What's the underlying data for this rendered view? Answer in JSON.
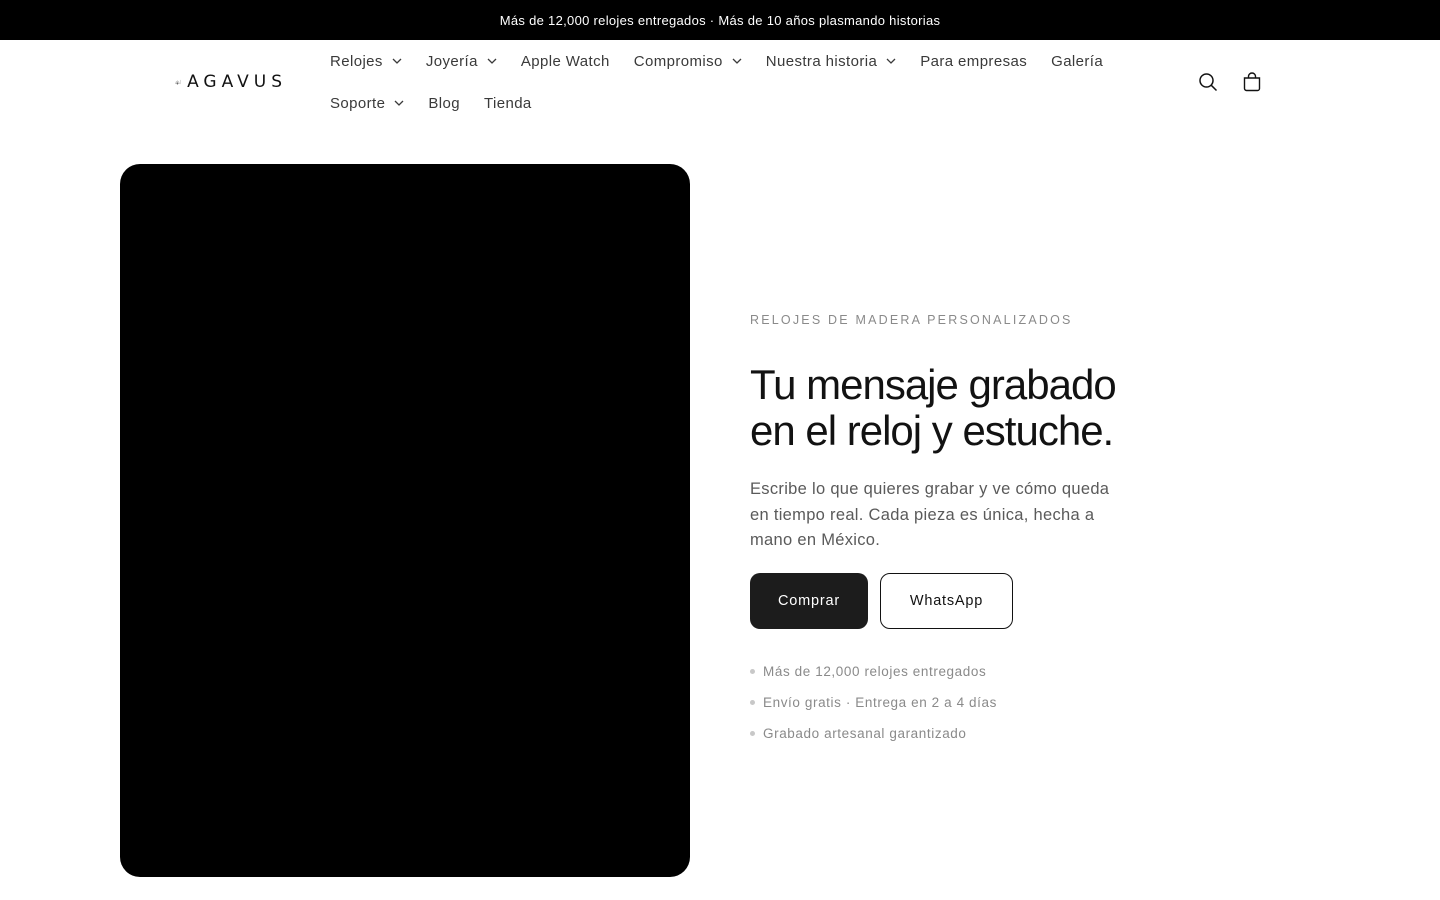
{
  "announcement": {
    "text": "Más de 12,000 relojes entregados · Más de 10 años plasmando historias"
  },
  "header": {
    "logo_icon": "agave-icon",
    "logo_text": "AGAVUS",
    "nav": [
      {
        "label": "Relojes",
        "dropdown": true
      },
      {
        "label": "Joyería",
        "dropdown": true
      },
      {
        "label": "Apple Watch",
        "dropdown": false
      },
      {
        "label": "Compromiso",
        "dropdown": true
      },
      {
        "label": "Nuestra historia",
        "dropdown": true
      },
      {
        "label": "Para empresas",
        "dropdown": false
      },
      {
        "label": "Galería",
        "dropdown": false
      },
      {
        "label": "Soporte",
        "dropdown": true
      },
      {
        "label": "Blog",
        "dropdown": false
      },
      {
        "label": "Tienda",
        "dropdown": false
      }
    ],
    "icons": [
      "search-icon",
      "cart-icon"
    ]
  },
  "hero": {
    "eyebrow": "RELOJES DE MADERA PERSONALIZADOS",
    "headline_line1": "Tu mensaje grabado",
    "headline_line2": "en el reloj y estuche.",
    "subtext": "Escribe lo que quieres grabar y ve cómo queda en tiempo real. Cada pieza es única, hecha a mano en México.",
    "primary_button": "Comprar",
    "secondary_button": "WhatsApp",
    "bullets": [
      "Más de 12,000 relojes entregados",
      "Envío gratis · Entrega en 2 a 4 días",
      "Grabado artesanal garantizado"
    ]
  },
  "colors": {
    "announcement_bg": "#000000",
    "text_primary": "#121212",
    "text_muted": "#8a8a8a",
    "button_primary_bg": "#1c1c1c",
    "media_bg": "#000000"
  }
}
